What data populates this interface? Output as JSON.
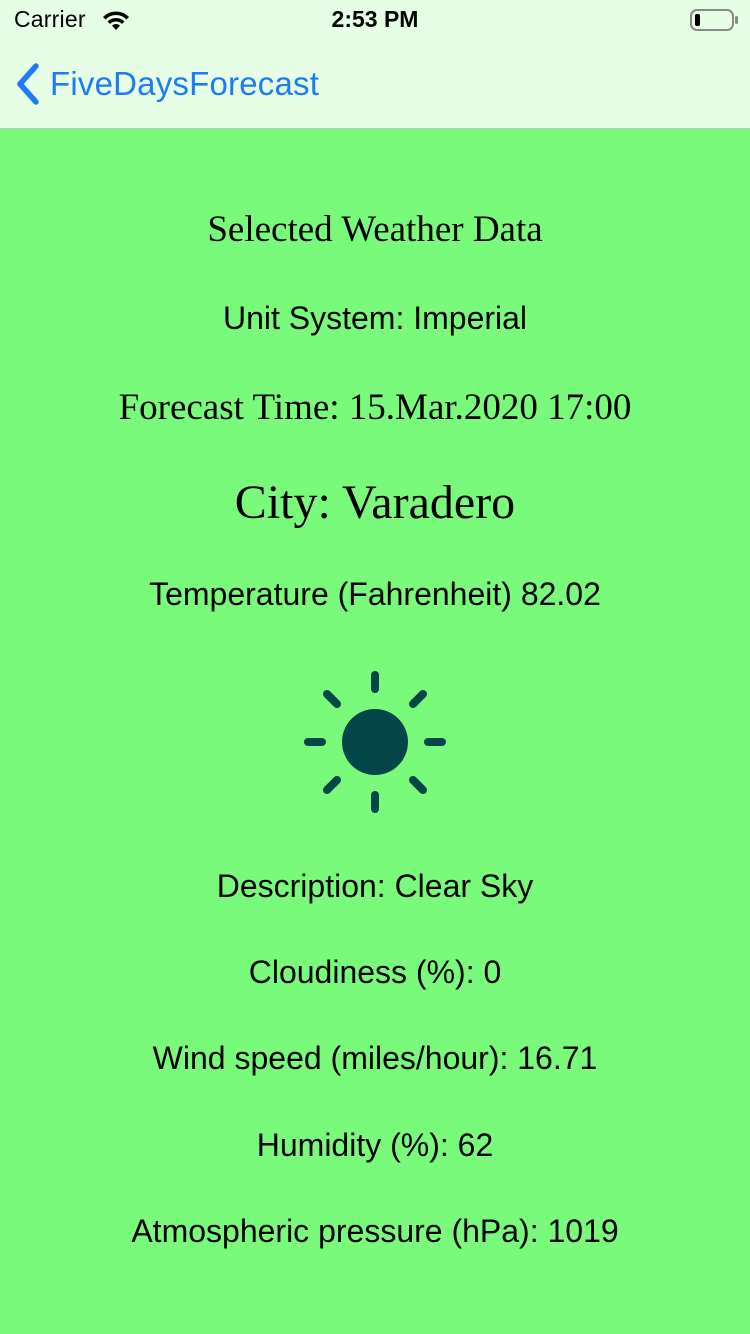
{
  "status_bar": {
    "carrier": "Carrier",
    "time": "2:53 PM",
    "wifi_icon": "wifi-icon",
    "battery_icon": "battery-icon"
  },
  "nav": {
    "back_label": "FiveDaysForecast",
    "back_icon": "chevron-left-icon",
    "accent_color": "#1d7cf3"
  },
  "colors": {
    "background": "#7afa7a",
    "nav_background": "#e6fde6",
    "sun_color": "#03464a"
  },
  "weather": {
    "heading": "Selected Weather Data",
    "unit_system": "Unit System: Imperial",
    "forecast_time": "Forecast Time: 15.Mar.2020 17:00",
    "city": "City: Varadero",
    "temperature": "Temperature (Fahrenheit)  82.02",
    "icon": "sun-icon",
    "description": "Description: Clear Sky",
    "cloudiness": "Cloudiness (%):  0",
    "wind_speed": "Wind speed (miles/hour): 16.71",
    "humidity": "Humidity (%):  62",
    "pressure": "Atmospheric pressure (hPa): 1019"
  }
}
